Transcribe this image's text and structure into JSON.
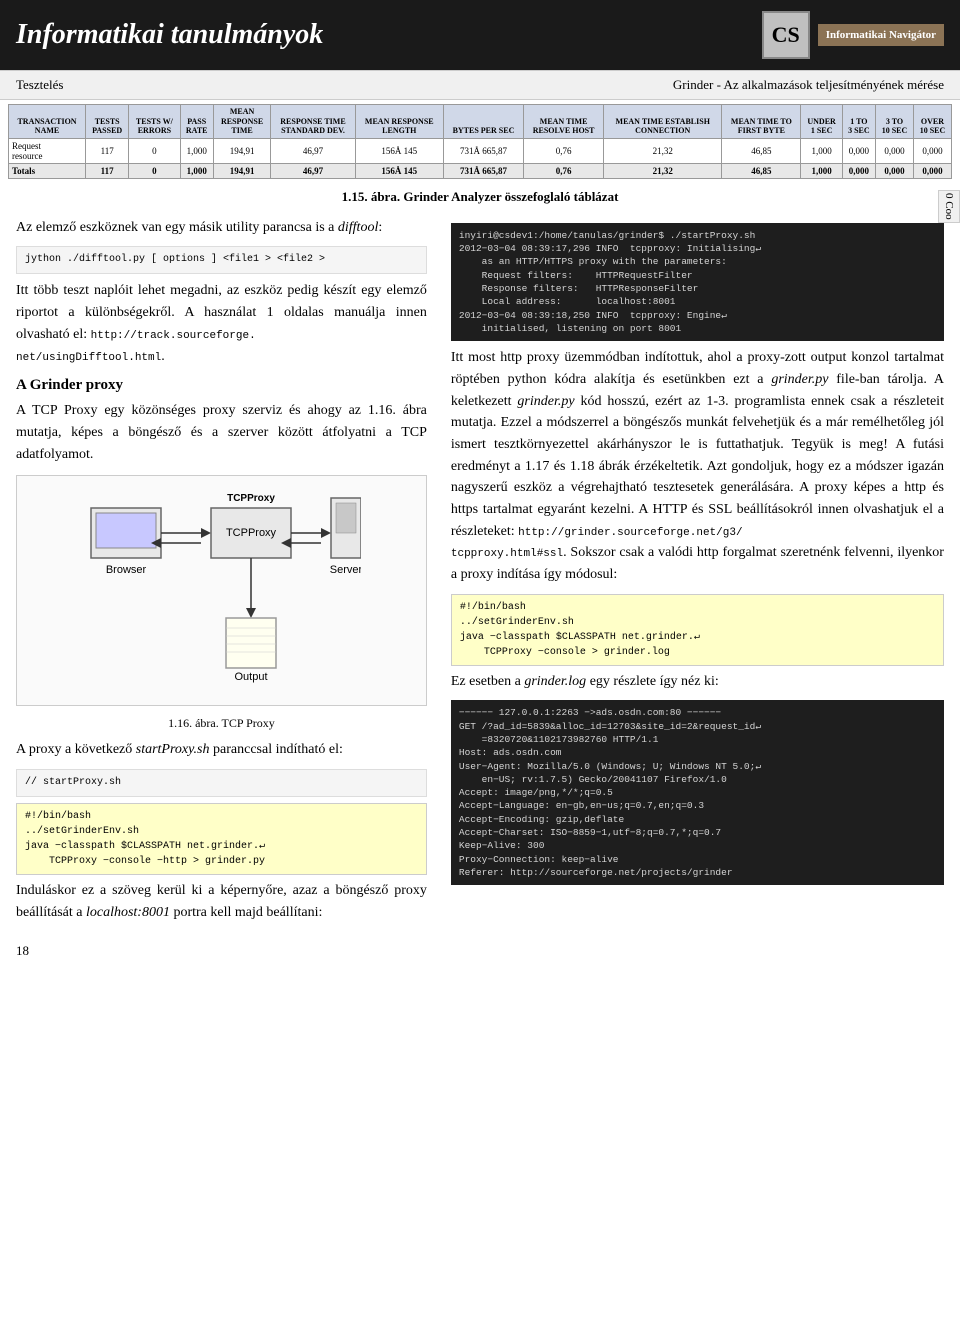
{
  "header": {
    "title": "Informatikai tanulmányok",
    "cs_label": "CS",
    "nav_label": "Informatikai Navigátor"
  },
  "subheader": {
    "left": "Tesztelés",
    "right": "Grinder - Az alkalmazások teljesítményének mérése"
  },
  "table": {
    "headers": [
      "Transaction Name",
      "Tests Passed",
      "Tests w/ Errors",
      "Pass Rate",
      "Mean Response Time",
      "Response Time Standard Dev.",
      "Mean Response Length",
      "Bytes per Sec",
      "Mean Time Resolve Host",
      "Mean Time Establish Connection",
      "Mean Time to First Byte",
      "Under 1 Sec",
      "1 to 3 Sec",
      "3 to 10 Sec",
      "Over 10 Sec"
    ],
    "rows": [
      {
        "name": "Request resource",
        "tests_passed": "117",
        "tests_errors": "0",
        "pass_rate": "1,000",
        "mean_response": "194,91",
        "std_dev": "46,97",
        "mean_length": "156Å 145",
        "bytes_sec": "731Å 665,87",
        "mean_resolve": "0,76",
        "mean_establish": "21,32",
        "mean_first_byte": "46,85",
        "under1": "1,000",
        "one_3": "0,000",
        "three_10": "0,000",
        "over10": "0,000"
      }
    ],
    "totals": {
      "name": "Totals",
      "tests_passed": "117",
      "tests_errors": "0",
      "pass_rate": "1,000",
      "mean_response": "194,91",
      "std_dev": "46,97",
      "mean_length": "156Å 145",
      "bytes_sec": "731Å 665,87",
      "mean_resolve": "0,76",
      "mean_establish": "21,32",
      "mean_first_byte": "46,85",
      "under1": "1,000",
      "one_3": "0,000",
      "three_10": "0,000",
      "over10": "0,000"
    }
  },
  "figure_caption": "1.15. ábra. Grinder Analyzer összefoglaló táblázat",
  "left_col": {
    "intro_p1": "Az elemző eszköznek van egy másik utility parancsa is a ",
    "difftool": "difftool",
    "intro_p1_end": ":",
    "difftool_cmd": "jython ./difftool.py [ options ] <file1 > <file2 >",
    "intro_p2": "Itt több teszt naplóit lehet megadni, az eszköz pedig készít egy elemző riportot a különbségekről. A használat 1 oldalas manuálja innen olvasható el: ",
    "manual_url": "http://track.sourceforge.net/usingDifftool.html",
    "intro_p2_end": ".",
    "section_title": "A Grinder proxy",
    "section_p1": "A TCP Proxy egy közönséges proxy szerviz és ahogy az 1.16. ábra mutatja, képes a böngésző és a szerver között átfolyatni a TCP adatfolyamot.",
    "diagram_caption": "1.16. ábra. TCP Proxy",
    "proxy_p1": "A proxy a következő ",
    "startproxy": "startProxy.sh",
    "proxy_p1_end": " paranccsal indítható el:",
    "code1": "// startProxy.sh",
    "code2": "#!/bin/bash\n../setGrinderEnv.sh\njava −classpath $CLASSPATH net.grinder.↵\n    TCPProxy −console −http > grinder.py",
    "ending_p": "Induláskor ez a szöveg kerül ki a képernyőre, azaz a böngésző proxy beállítását a localhost:8001 portra kell majd beállítani:"
  },
  "right_col": {
    "terminal_block": "inyiri@csdev1:/home/tanulas/grinder$ ./startProxy.sh\n2012−03−04 08:39:17,296 INFO  tcpproxy: Initialising↵\n    as an HTTP/HTTPS proxy with the parameters:\n    Request filters:    HTTPRequestFilter\n    Response filters:   HTTPResponseFilter\n    Local address:      localhost:8001\n2012−03−04 08:39:18,250 INFO  tcpproxy: Engine↵\n    initialised, listening on port 8001",
    "p1": "Itt most http proxy üzemmódban indítottuk, ahol a proxy-zott output konzol tartalmat röptében python kódra alakítja és esetünkben ezt a ",
    "grinder_py": "grinder.py",
    "p1_mid": " file-ban tárolja. A keletkezett ",
    "grinder_py2": "grinder.py",
    "p1_end": " kód hosszú, ezért az 1-3. programlista ennek csak a részleteit mutatja. Ezzel a módszerrel a böngészős munkát felvehetjük és a már remélhetőleg jól ismert tesztkörnyezettel akárhányszor le is futtathatjuk. Tegyük is meg! A futási eredményt a 1.17 és 1.18 ábrák érzékeltetik. Azt gondoljuk, hogy ez a módszer igazán nagyszerű eszköz a végrehajtható tesztesetek generálására. A proxy képes a http és https tartalmat egyaránt kezelni. A HTTP és SSL beállításokról innen olvashatjuk el a részleteket: ",
    "ssl_url": "http://grinder.sourceforge.net/g3/tcpproxy.html#ssl",
    "p1_end2": ". Sokszor csak a valódi http forgalmat szeretnénk felvenni, ilyenkor a proxy indítása így módosul:",
    "bash_block": "#!/bin/bash\n../setGrinderEnv.sh\njava −classpath $CLASSPATH net.grinder.↵\n    TCPProxy −console > grinder.log",
    "p2": "Ez esetben a ",
    "grinder_log": "grinder.log",
    "p2_end": " egy részlete így néz ki:",
    "log_block": "−−−−−− 127.0.0.1:2263 −>ads.osdn.com:80 −−−−−−\nGET /?ad_id=5839&alloc_id=12703&site_id=2&request_id↵\n    =8320720&1102173982760 HTTP/1.1\nHost: ads.osdn.com\nUser−Agent: Mozilla/5.0 (Windows; U; Windows NT 5.0;↵\n    en−US; rv:1.7.5) Gecko/20041107 Firefox/1.0\nAccept: image/png,*/*;q=0.5\nAccept−Language: en−gb,en−us;q=0.7,en;q=0.3\nAccept−Encoding: gzip,deflate\nAccept−Charset: ISO−8859−1,utf−8;q=0.7,*;q=0.7\nKeep−Alive: 300\nProxy−Connection: keep−alive\nReferer: http://sourceforge.net/projects/grinder"
  },
  "page_number": "18",
  "cookie_label": "0 Coo"
}
